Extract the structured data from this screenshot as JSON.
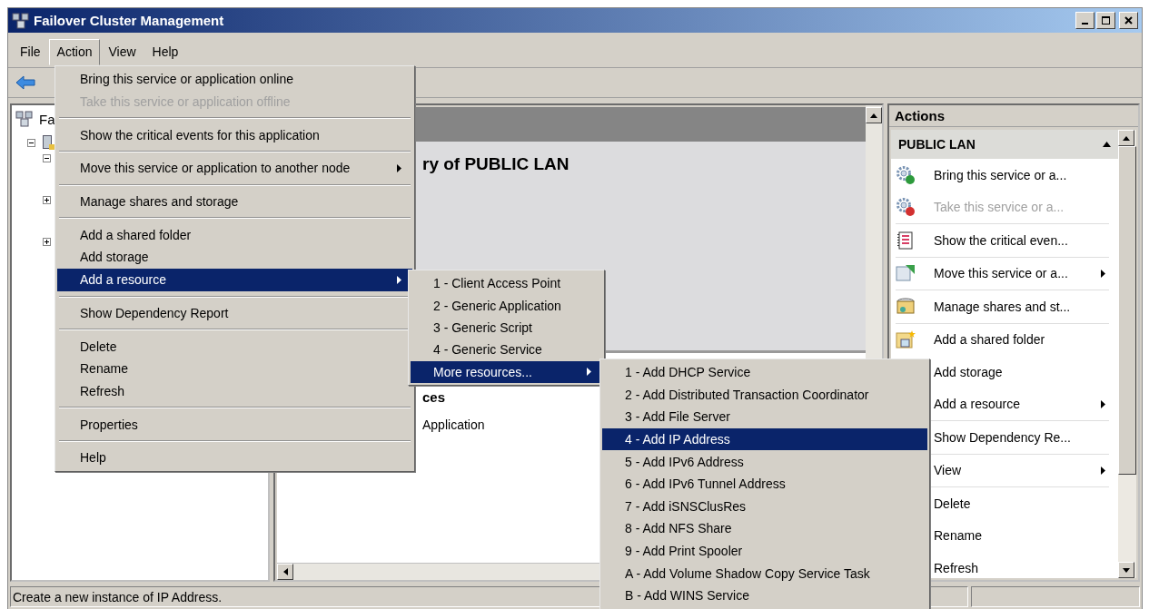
{
  "window": {
    "title": "Failover Cluster Management"
  },
  "menu_bar": [
    {
      "label": "File",
      "selected": false
    },
    {
      "label": "Action",
      "selected": true
    },
    {
      "label": "View",
      "selected": false
    },
    {
      "label": "Help",
      "selected": false
    }
  ],
  "tree": [
    {
      "label": "Fa",
      "children": [
        {
          "expanded": true,
          "children": [
            {
              "expanded": true
            },
            {
              "expanded": false
            },
            {
              "expanded": false
            }
          ]
        }
      ]
    }
  ],
  "center": {
    "heading": "ry of PUBLIC LAN",
    "section_heading": "ces",
    "rows": [
      {
        "label": "Application"
      }
    ]
  },
  "actions": {
    "title": "Actions",
    "section": {
      "label": "PUBLIC LAN",
      "expanded": true
    },
    "groups": [
      {
        "items": [
          {
            "label": "Bring this service or a...",
            "kind": "gear_up",
            "disabled": false,
            "submenu": false
          },
          {
            "label": "Take this service or a...",
            "kind": "gear_down",
            "disabled": true,
            "submenu": false
          }
        ]
      },
      {
        "items": [
          {
            "label": "Show the critical even...",
            "kind": "event_log",
            "disabled": false,
            "submenu": false
          }
        ]
      },
      {
        "items": [
          {
            "label": "Move this service or a...",
            "kind": "move",
            "disabled": false,
            "submenu": true
          }
        ]
      },
      {
        "items": [
          {
            "label": "Manage shares and st...",
            "kind": "shares",
            "disabled": false,
            "submenu": false
          }
        ]
      },
      {
        "items": [
          {
            "label": "Add a shared folder",
            "kind": "folder",
            "disabled": false,
            "submenu": false
          },
          {
            "label": "Add storage",
            "kind": "plain",
            "disabled": false,
            "submenu": false
          },
          {
            "label": "Add a resource",
            "kind": "plain",
            "disabled": false,
            "submenu": true
          }
        ]
      },
      {
        "items": [
          {
            "label": "Show Dependency Re...",
            "kind": "plain",
            "disabled": false,
            "submenu": false
          }
        ]
      },
      {
        "items": [
          {
            "label": "View",
            "kind": "plain",
            "disabled": false,
            "submenu": true
          }
        ]
      },
      {
        "items": [
          {
            "label": "Delete",
            "kind": "plain",
            "disabled": false,
            "submenu": false
          },
          {
            "label": "Rename",
            "kind": "plain",
            "disabled": false,
            "submenu": false
          },
          {
            "label": "Refresh",
            "kind": "plain",
            "disabled": false,
            "submenu": false
          }
        ]
      }
    ]
  },
  "action_menu": {
    "groups": [
      {
        "items": [
          {
            "label": "Bring this service or application online",
            "disabled": false,
            "submenu": false,
            "selected": false
          },
          {
            "label": "Take this service or application offline",
            "disabled": true,
            "submenu": false,
            "selected": false
          }
        ]
      },
      {
        "items": [
          {
            "label": "Show the critical events for this application",
            "disabled": false,
            "submenu": false,
            "selected": false
          }
        ]
      },
      {
        "items": [
          {
            "label": "Move this service or application to another node",
            "disabled": false,
            "submenu": true,
            "selected": false
          }
        ]
      },
      {
        "items": [
          {
            "label": "Manage shares and storage",
            "disabled": false,
            "submenu": false,
            "selected": false
          }
        ]
      },
      {
        "items": [
          {
            "label": "Add a shared folder",
            "disabled": false,
            "submenu": false,
            "selected": false
          },
          {
            "label": "Add storage",
            "disabled": false,
            "submenu": false,
            "selected": false
          },
          {
            "label": "Add a resource",
            "disabled": false,
            "submenu": true,
            "selected": true
          }
        ]
      },
      {
        "items": [
          {
            "label": "Show Dependency Report",
            "disabled": false,
            "submenu": false,
            "selected": false
          }
        ]
      },
      {
        "items": [
          {
            "label": "Delete",
            "disabled": false,
            "submenu": false,
            "selected": false
          },
          {
            "label": "Rename",
            "disabled": false,
            "submenu": false,
            "selected": false
          },
          {
            "label": "Refresh",
            "disabled": false,
            "submenu": false,
            "selected": false
          }
        ]
      },
      {
        "items": [
          {
            "label": "Properties",
            "disabled": false,
            "submenu": false,
            "selected": false
          }
        ]
      },
      {
        "items": [
          {
            "label": "Help",
            "disabled": false,
            "submenu": false,
            "selected": false
          }
        ]
      }
    ]
  },
  "resource_menu": {
    "items": [
      {
        "label": "1 - Client Access Point",
        "submenu": false,
        "selected": false
      },
      {
        "label": "2 - Generic Application",
        "submenu": false,
        "selected": false
      },
      {
        "label": "3 - Generic Script",
        "submenu": false,
        "selected": false
      },
      {
        "label": "4 - Generic Service",
        "submenu": false,
        "selected": false
      },
      {
        "label": "More resources...",
        "submenu": true,
        "selected": true
      }
    ]
  },
  "more_resources_menu": {
    "items": [
      {
        "label": "1 - Add DHCP Service",
        "selected": false
      },
      {
        "label": "2 - Add Distributed Transaction Coordinator",
        "selected": false
      },
      {
        "label": "3 - Add File Server",
        "selected": false
      },
      {
        "label": "4 - Add IP Address",
        "selected": true
      },
      {
        "label": "5 - Add IPv6 Address",
        "selected": false
      },
      {
        "label": "6 - Add IPv6 Tunnel Address",
        "selected": false
      },
      {
        "label": "7 - Add iSNSClusRes",
        "selected": false
      },
      {
        "label": "8 - Add NFS Share",
        "selected": false
      },
      {
        "label": "9 - Add Print Spooler",
        "selected": false
      },
      {
        "label": "A - Add Volume Shadow Copy Service Task",
        "selected": false
      },
      {
        "label": "B - Add WINS Service",
        "selected": false
      }
    ]
  },
  "status_bar": {
    "text": "Create a new instance of IP Address."
  }
}
